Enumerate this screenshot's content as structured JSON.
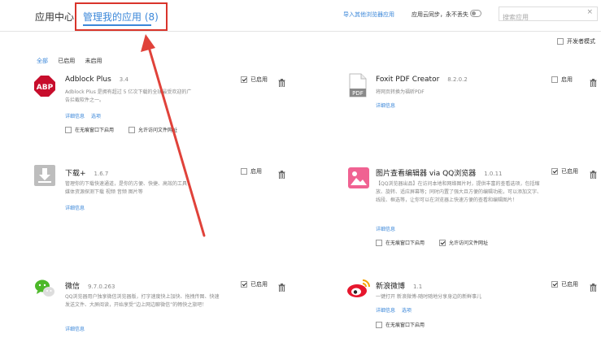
{
  "header": {
    "tab_home": "应用中心",
    "tab_mine": "管理我的应用",
    "tab_mine_count": "(8)",
    "import_link": "导入其他浏览器应用",
    "sync_label": "应用云同步，永不丢失",
    "sync_on": false,
    "search_placeholder": "搜索应用",
    "clear_symbol": "×"
  },
  "dev_mode_label": "开发者模式",
  "filters": [
    "全部",
    "已启用",
    "未启用"
  ],
  "enabled_label": "已启用",
  "disabled_label": "启用",
  "apps": [
    {
      "name": "Adblock Plus",
      "version": "3.4",
      "icon": "abp-icon",
      "icon_text": "ABP",
      "enabled": true,
      "description": "Adblock Plus 是拥有超过 5 亿次下载的全球最受欢迎的广告拦截软件之一。",
      "links": [
        "详细信息",
        "选项"
      ],
      "options": [
        "在无痕窗口下启用",
        "允许访问文件网址"
      ]
    },
    {
      "name": "Foxit PDF Creator",
      "version": "8.2.0.2",
      "icon": "pdf-file-icon",
      "icon_text": "PDF",
      "enabled": false,
      "description": "将网页转换为福昕PDF",
      "links": [
        "详细信息"
      ],
      "options": []
    },
    {
      "name": "下载+",
      "version": "1.6.7",
      "icon": "download-arrow-icon",
      "enabled": false,
      "description": "管理你的下载快速通道，是你的方便、快捷、高效的工具！媒体资源探测下载 视频 音频 图片等",
      "links": [
        "详细信息"
      ],
      "options": []
    },
    {
      "name": "图片查看编辑器 via QQ浏览器",
      "version": "1.0.11",
      "icon": "image-editor-icon",
      "enabled": true,
      "description": "【QQ浏览器出品】在访问本地和网络图片时，提供丰富的查看选项，包括缩放、旋转、适应屏幕等；同时内置了强大且方便的编辑功能，可以添加文字、线段、框选等，让你可以在浏览器上快速方便的查看和编辑图片！",
      "links": [
        "详细信息"
      ],
      "options": [
        "在无痕窗口下启用",
        "允许访问文件网址"
      ],
      "options_checked": [
        false,
        true
      ]
    },
    {
      "name": "微信",
      "version": "9.7.0.263",
      "icon": "wechat-icon",
      "enabled": true,
      "description": "QQ浏览器用户独享微信浏览器版，打字速度快上加快、拖拽传图、快速发送文件、大屏阅读，开始享受“边上网边聊微信”的畅快之旅吧！",
      "links": [
        "详细信息"
      ],
      "options": []
    },
    {
      "name": "新浪微博",
      "version": "1.1",
      "icon": "weibo-icon",
      "enabled": true,
      "description": "一键打开 新浪微博-随时随地分享身边的新鲜事儿",
      "links": [
        "详细信息",
        "选项"
      ],
      "options": [
        "在无痕窗口下启用"
      ],
      "options_checked": [
        false
      ]
    }
  ],
  "colors": {
    "accent": "#3b87d9",
    "highlight_box": "#d9342b",
    "annotation_arrow": "#e0423a",
    "abp_red": "#c70d2c",
    "wechat_green": "#4cb829",
    "weibo_red": "#e6162d",
    "image_editor_pink": "#f06292"
  }
}
